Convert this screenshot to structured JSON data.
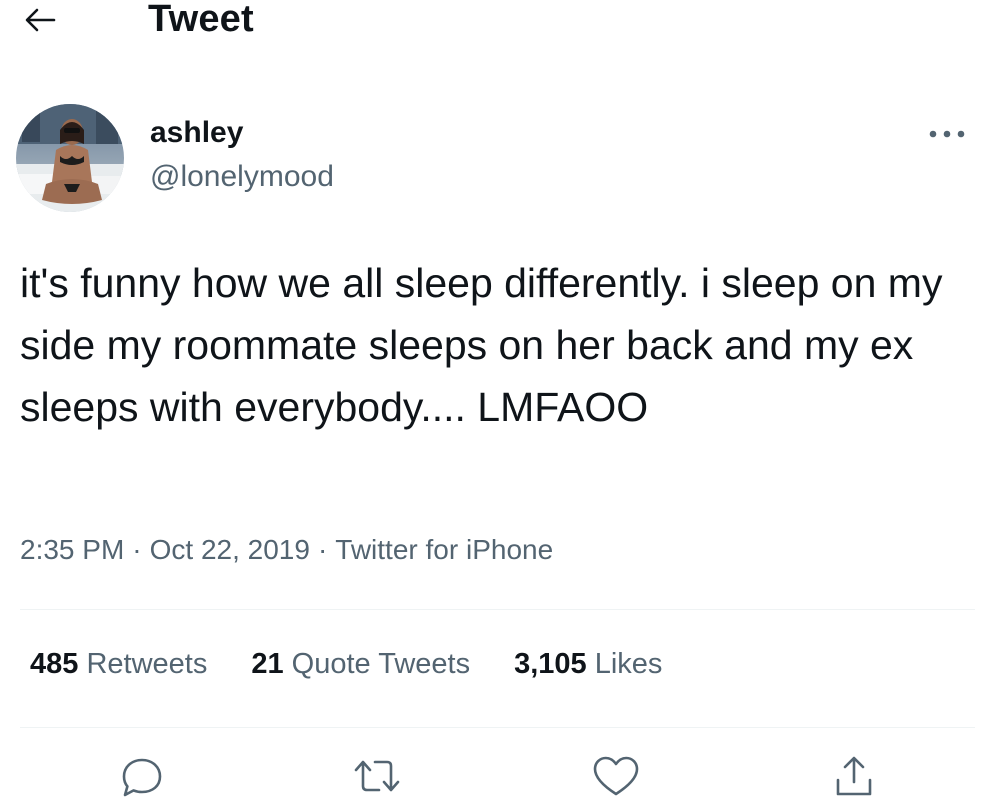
{
  "header": {
    "title": "Tweet",
    "back_icon": "arrow-left-icon"
  },
  "author": {
    "display_name": "ashley",
    "handle": "@lonelymood",
    "avatar": "profile-photo"
  },
  "tweet": {
    "text": "it's funny how we all sleep differently. i sleep on my side my roommate sleeps on her back and my ex sleeps with everybody.... LMFAOO",
    "time": "2:35 PM",
    "date": "Oct 22, 2019",
    "source": "Twitter for iPhone",
    "separator": "·"
  },
  "stats": {
    "retweets_count": "485",
    "retweets_label": "Retweets",
    "quotes_count": "21",
    "quotes_label": "Quote Tweets",
    "likes_count": "3,105",
    "likes_label": "Likes"
  },
  "actions": [
    "reply-icon",
    "retweet-icon",
    "like-icon",
    "share-icon"
  ],
  "colors": {
    "text_primary": "#0f1419",
    "text_secondary": "#536471",
    "divider": "#eff3f4",
    "background": "#ffffff"
  }
}
